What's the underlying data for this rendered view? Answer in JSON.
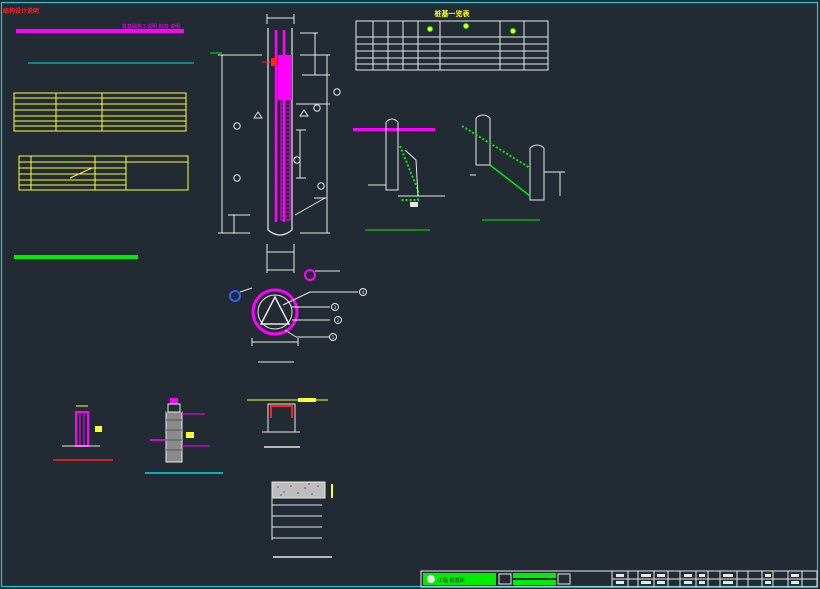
{
  "sheet": {
    "corner_label": "结构设计说明",
    "notes_title": "桩基础施工说明 桩基 说明",
    "pile_table_title": "桩基一览表",
    "title_block_left": "工程 桩基础",
    "colors": {
      "background": "#222b33",
      "frame": "#21c4d0",
      "white": "#e8e8e8",
      "magenta": "#ff00ff",
      "yellow": "#ffff33",
      "green": "#00ee00",
      "red": "#ff2020",
      "cyan": "#00d8e8",
      "blue": "#3060ff"
    }
  },
  "section_callouts": [
    "4",
    "3",
    "2",
    "1"
  ]
}
